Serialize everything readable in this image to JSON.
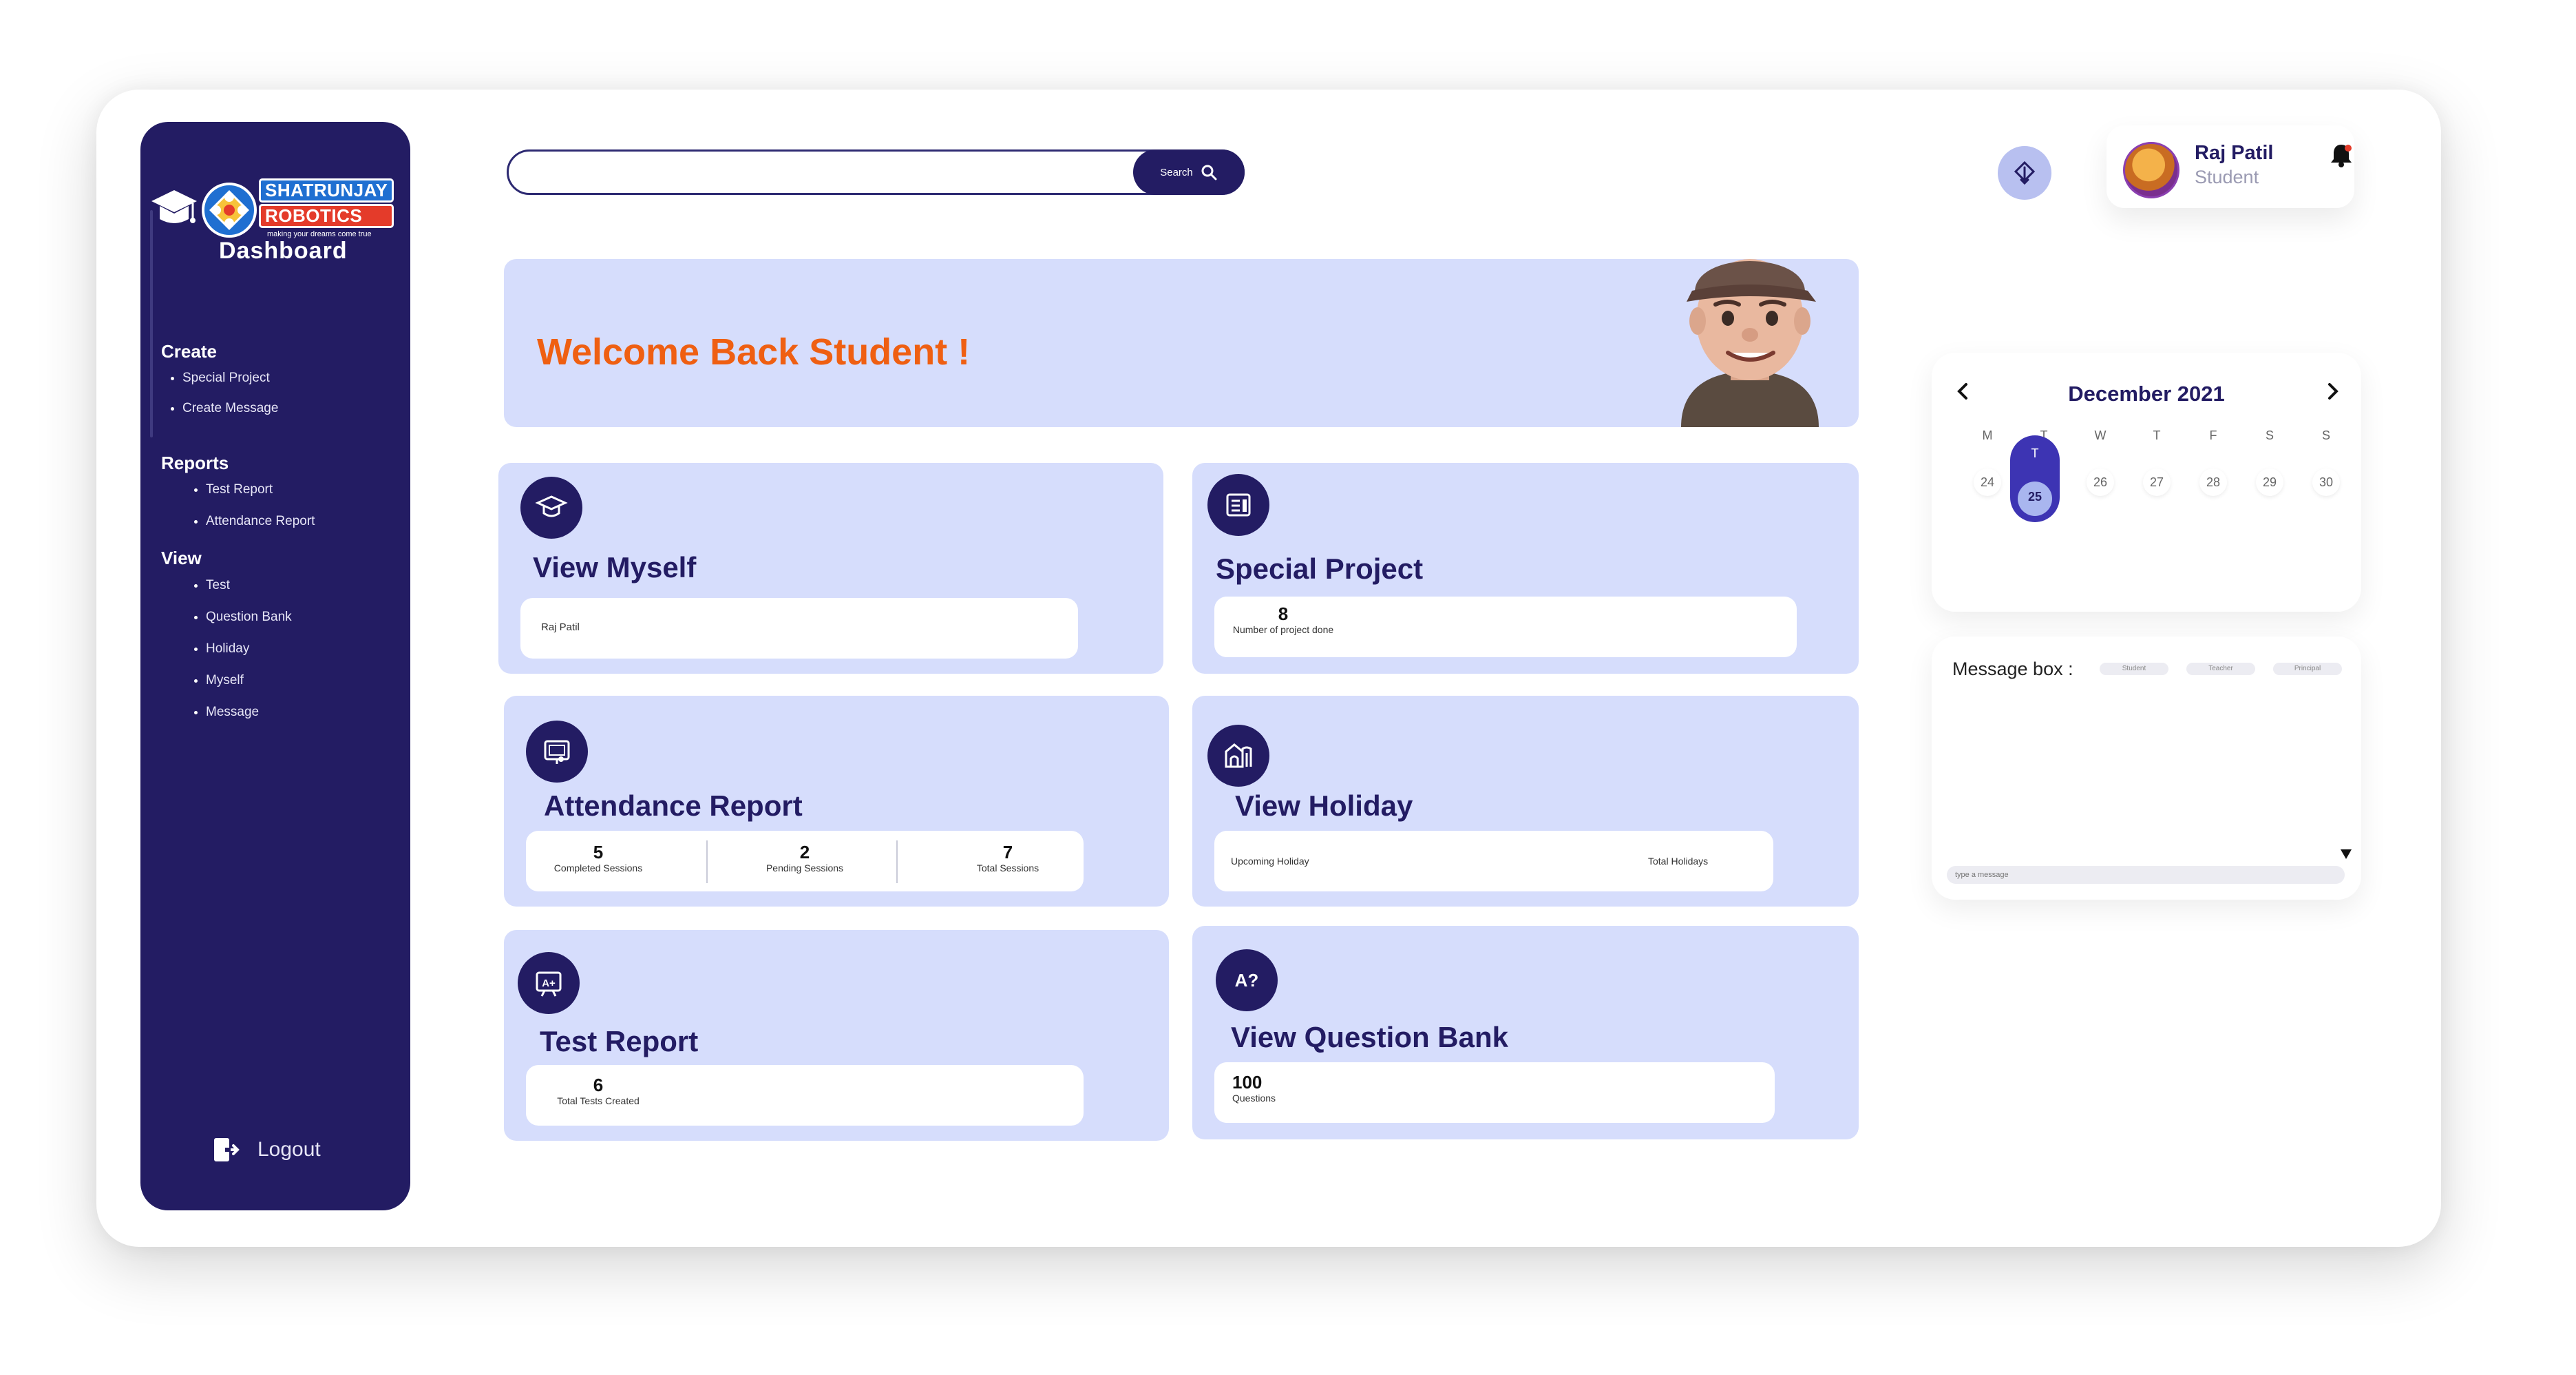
{
  "sidebar": {
    "logo": {
      "line1": "SHATRUNJAY",
      "line2": "ROBOTICS",
      "tagline": "making your dreams come true"
    },
    "title": "Dashboard",
    "sections": [
      {
        "heading": "Create",
        "items": [
          "Special Project",
          "Create Message"
        ]
      },
      {
        "heading": "Reports",
        "items": [
          "Test Report",
          "Attendance Report"
        ]
      },
      {
        "heading": "View",
        "items": [
          "Test",
          "Question Bank",
          "Holiday",
          "Myself",
          "Message"
        ]
      }
    ],
    "logout": "Logout"
  },
  "search": {
    "placeholder": "",
    "button": "Search",
    "icon": "search-icon"
  },
  "header": {
    "user_name": "Raj Patil",
    "user_role": "Student",
    "icons": [
      "swap-icon",
      "notification-bell-icon"
    ]
  },
  "welcome": {
    "text": "Welcome Back Student !"
  },
  "cards": {
    "view_myself": {
      "title": "View Myself",
      "value": "Raj Patil",
      "icon": "graduate-icon"
    },
    "special_project": {
      "title": "Special Project",
      "count": "8",
      "label": "Number of project done",
      "icon": "project-icon"
    },
    "attendance": {
      "title": "Attendance Report",
      "icon": "presentation-icon",
      "stats": [
        {
          "value": "5",
          "label": "Completed Sessions"
        },
        {
          "value": "2",
          "label": "Pending Sessions"
        },
        {
          "value": "7",
          "label": "Total Sessions"
        }
      ]
    },
    "holiday": {
      "title": "View Holiday",
      "left_label": "Upcoming Holiday",
      "right_label": "Total Holidays",
      "icon": "building-icon"
    },
    "test_report": {
      "title": "Test Report",
      "count": "6",
      "label": "Total Tests Created",
      "icon": "grade-board-icon"
    },
    "question_bank": {
      "title": "View Question Bank",
      "count": "100",
      "label": "Questions",
      "icon": "question-icon"
    }
  },
  "calendar": {
    "month": "December 2021",
    "weekdays": [
      "M",
      "T",
      "W",
      "T",
      "F",
      "S",
      "S"
    ],
    "days": [
      "24",
      "25",
      "26",
      "27",
      "28",
      "29",
      "30"
    ],
    "selected_day": "25"
  },
  "message_box": {
    "label": "Message box :",
    "chips": [
      "Student",
      "Teacher",
      "Principal"
    ],
    "input_placeholder": "type a message"
  },
  "colors": {
    "primary": "#231c63",
    "card_bg": "#d6ddfc",
    "accent": "#ef5f12"
  }
}
